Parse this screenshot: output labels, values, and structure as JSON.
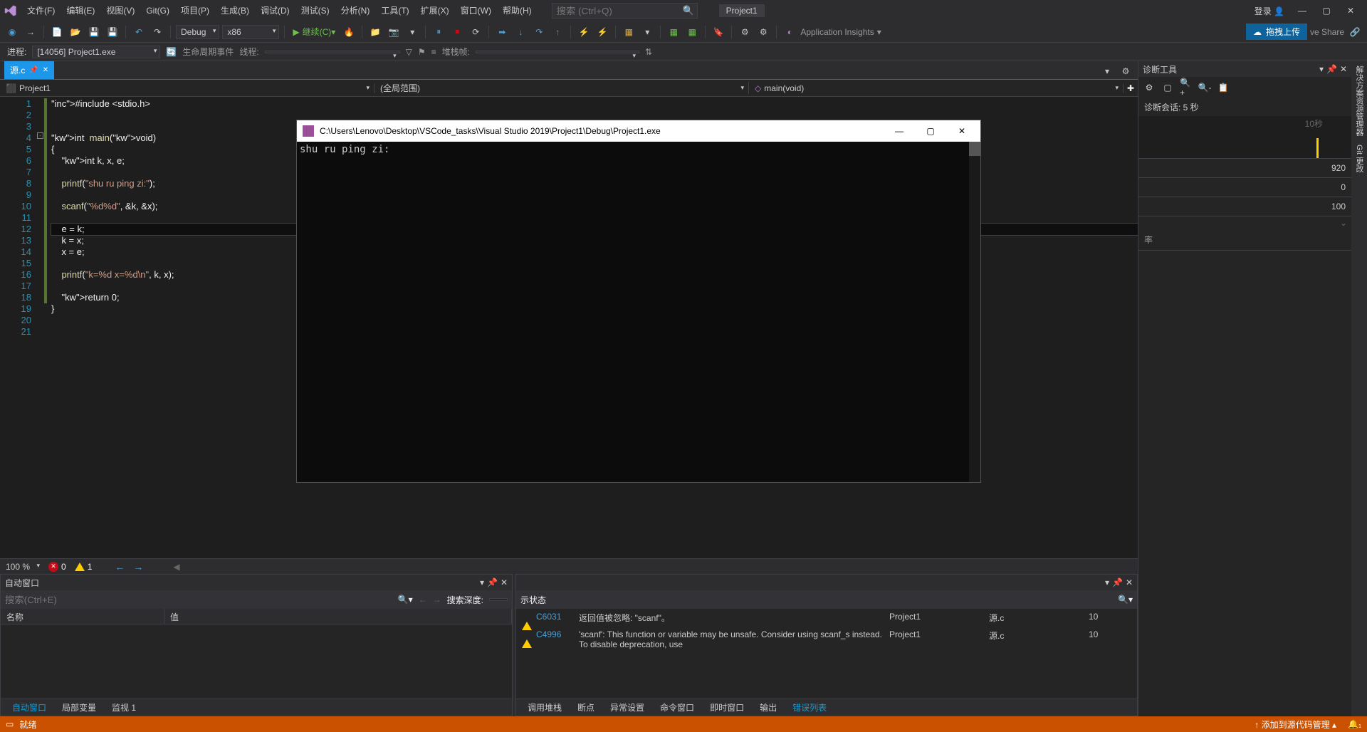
{
  "titlebar": {
    "menus": [
      "文件(F)",
      "编辑(E)",
      "视图(V)",
      "Git(G)",
      "项目(P)",
      "生成(B)",
      "调试(D)",
      "测试(S)",
      "分析(N)",
      "工具(T)",
      "扩展(X)",
      "窗口(W)",
      "帮助(H)"
    ],
    "search_placeholder": "搜索 (Ctrl+Q)",
    "project": "Project1",
    "login": "登录",
    "upload": "拖拽上传",
    "liveshare": "ve Share"
  },
  "toolbar": {
    "config": "Debug",
    "platform": "x86",
    "continue": "继续(C)",
    "insights": "Application Insights"
  },
  "toolbar2": {
    "process_label": "进程:",
    "process": "[14056] Project1.exe",
    "life_events": "生命周期事件",
    "thread": "线程:",
    "stackframe": "堆栈帧:"
  },
  "filetab": {
    "name": "源.c"
  },
  "scope": {
    "project": "Project1",
    "scope2": "(全局范围)",
    "scope3": "main(void)"
  },
  "code": {
    "lines": [
      "#include <stdio.h>",
      "",
      "",
      "int  main(void)",
      "{",
      "    int k, x, e;",
      "",
      "    printf(\"shu ru ping zi:\");",
      "",
      "    scanf(\"%d%d\", &k, &x);",
      "",
      "    e = k;",
      "    k = x;",
      "    x = e;",
      "",
      "    printf(\"k=%d x=%d\\n\", k, x);",
      "",
      "    return 0;",
      "}",
      "",
      ""
    ],
    "highlight_line": 12
  },
  "editorbar": {
    "zoom": "100 %",
    "errors": "0",
    "warnings": "1"
  },
  "autowin": {
    "title": "自动窗口",
    "search_placeholder": "搜索(Ctrl+E)",
    "depth_label": "搜索深度:",
    "cols": [
      "名称",
      "值"
    ],
    "tabs": [
      "自动窗口",
      "局部变量",
      "监视 1"
    ]
  },
  "errorlist": {
    "rows": [
      {
        "code": "C6031",
        "desc": "返回值被忽略: \"scanf\"。",
        "proj": "Project1",
        "file": "源.c",
        "line": "10"
      },
      {
        "code": "C4996",
        "desc": "'scanf': This function or variable may be unsafe. Consider using scanf_s instead. To disable deprecation, use",
        "proj": "Project1",
        "file": "源.c",
        "line": "10"
      }
    ],
    "status_col": "示状态",
    "tabs": [
      "调用堆栈",
      "断点",
      "异常设置",
      "命令窗口",
      "即时窗口",
      "输出",
      "错误列表"
    ]
  },
  "diag": {
    "title": "诊断工具",
    "session": "诊断会话: 5 秒",
    "time_label": "10秒",
    "metrics": [
      {
        "label": "",
        "val": "920"
      },
      {
        "label": "",
        "val": "0"
      },
      {
        "label": "",
        "val": "100"
      }
    ],
    "rate": "率"
  },
  "sidestrip": [
    "解决方案资源管理器",
    "Git 更改"
  ],
  "console": {
    "title": "C:\\Users\\Lenovo\\Desktop\\VSCode_tasks\\Visual Studio 2019\\Project1\\Debug\\Project1.exe",
    "output": "shu ru ping zi:"
  },
  "statusbar": {
    "ready": "就绪",
    "addrepo": "添加到源代码管理"
  }
}
